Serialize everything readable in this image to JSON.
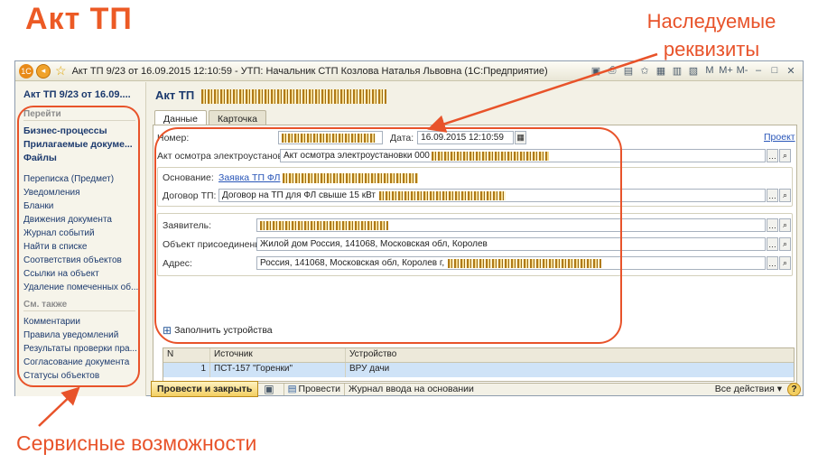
{
  "overlay": {
    "title": "Акт  ТП",
    "callout_inherited_line1": "Наследуемые",
    "callout_inherited_line2": "реквизиты",
    "callout_services": "Сервисные возможности",
    "accent_color": "#e8532a"
  },
  "window": {
    "title": "Акт ТП 9/23 от 16.09.2015 12:10:59 - УТП: Начальник СТП  Козлова Наталья Львовна  (1С:Предприятие)",
    "tools": [
      "M",
      "M+",
      "M-"
    ]
  },
  "sidebar": {
    "doc_head": "Акт ТП 9/23 от 16.09....",
    "section_go": "Перейти",
    "strong_items": [
      "Бизнес-процессы",
      "Прилагаемые докуме...",
      "Файлы"
    ],
    "items": [
      "Переписка (Предмет)",
      "Уведомления",
      "Бланки",
      "Движения документа",
      "Журнал событий",
      "Найти в списке",
      "Соответствия объектов",
      "Ссылки на объект",
      "Удаление помеченных об..."
    ],
    "section_see_also": "См. также",
    "see_also_items": [
      "Комментарии",
      "Правила уведомлений",
      "Результаты проверки пра...",
      "Согласование документа",
      "Статусы объектов"
    ]
  },
  "main": {
    "doc_title": "Акт ТП",
    "tabs": [
      "Данные",
      "Карточка"
    ],
    "number_label": "Номер:",
    "date_label": "Дата:",
    "date_value": "16.09.2015 12:10:59",
    "draft_link": "Проект",
    "inspection_label": "Акт осмотра электроустановки:",
    "inspection_value": "Акт осмотра электроустановки 000",
    "basis_label": "Основание:",
    "basis_link": "Заявка ТП ФЛ",
    "contract_label": "Договор ТП:",
    "contract_value": "Договор на ТП для ФЛ свыше 15 кВт",
    "applicant_label": "Заявитель:",
    "object_label": "Объект присоединения:",
    "object_value": "Жилой дом Россия, 141068, Московская обл, Королев",
    "address_label": "Адрес:",
    "address_value": "Россия, 141068, Московская обл, Королев г,",
    "fill_devices": "Заполнить устройства",
    "table": {
      "headers": [
        "N",
        "Источник",
        "Устройство"
      ],
      "rows": [
        [
          "1",
          "ПСТ-157 \"Горенки\"",
          "ВРУ дачи"
        ]
      ]
    },
    "post_close": "Провести и закрыть",
    "post": "Провести",
    "journal": "Журнал ввода на основании",
    "all_actions": "Все действия ▾"
  }
}
